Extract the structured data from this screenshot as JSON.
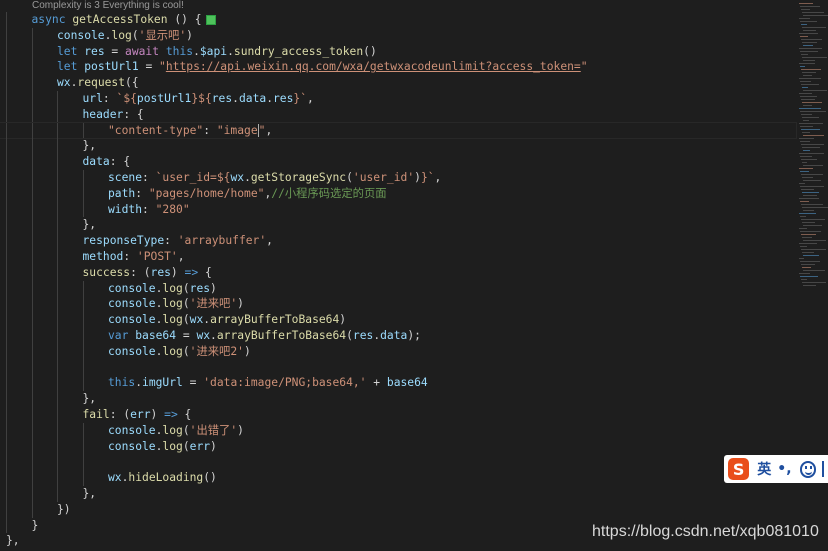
{
  "codelens": "Complexity is 3 Everything is cool!",
  "code": [
    {
      "indent": 1,
      "tokens": [
        [
          "kw",
          "async "
        ],
        [
          "fn",
          "getAccessToken"
        ],
        [
          "pun",
          " () {"
        ]
      ],
      "lens": true
    },
    {
      "indent": 2,
      "tokens": [
        [
          "var",
          "console"
        ],
        [
          "pun",
          "."
        ],
        [
          "fn",
          "log"
        ],
        [
          "pun",
          "("
        ],
        [
          "str",
          "'显示吧'"
        ],
        [
          "pun",
          ")"
        ]
      ]
    },
    {
      "indent": 2,
      "tokens": [
        [
          "kw",
          "let "
        ],
        [
          "var",
          "res"
        ],
        [
          "pun",
          " = "
        ],
        [
          "ctl",
          "await "
        ],
        [
          "kw",
          "this"
        ],
        [
          "pun",
          "."
        ],
        [
          "var",
          "$api"
        ],
        [
          "pun",
          "."
        ],
        [
          "fn",
          "sundry_access_token"
        ],
        [
          "pun",
          "()"
        ]
      ]
    },
    {
      "indent": 2,
      "tokens": [
        [
          "kw",
          "let "
        ],
        [
          "var",
          "postUrl1"
        ],
        [
          "pun",
          " = "
        ],
        [
          "str",
          "\""
        ],
        [
          "url",
          "https://api.weixin.qq.com/wxa/getwxacodeunlimit?access_token="
        ],
        [
          "str",
          "\""
        ]
      ]
    },
    {
      "indent": 2,
      "tokens": [
        [
          "var",
          "wx"
        ],
        [
          "pun",
          "."
        ],
        [
          "fn",
          "request"
        ],
        [
          "pun",
          "({"
        ]
      ]
    },
    {
      "indent": 3,
      "tokens": [
        [
          "var",
          "url"
        ],
        [
          "pun",
          ": "
        ],
        [
          "str",
          "`${"
        ],
        [
          "var",
          "postUrl1"
        ],
        [
          "str",
          "}${"
        ],
        [
          "var",
          "res"
        ],
        [
          "pun",
          "."
        ],
        [
          "var",
          "data"
        ],
        [
          "pun",
          "."
        ],
        [
          "var",
          "res"
        ],
        [
          "str",
          "}`"
        ],
        [
          "pun",
          ","
        ]
      ]
    },
    {
      "indent": 3,
      "tokens": [
        [
          "var",
          "header"
        ],
        [
          "pun",
          ": {"
        ]
      ]
    },
    {
      "indent": 4,
      "tokens": [
        [
          "str",
          "\"content-type\""
        ],
        [
          "pun",
          ": "
        ],
        [
          "str",
          "\"image"
        ],
        [
          "cursor",
          ""
        ],
        [
          "str",
          "\""
        ],
        [
          "pun",
          ","
        ]
      ],
      "current": true
    },
    {
      "indent": 3,
      "tokens": [
        [
          "pun",
          "},"
        ]
      ]
    },
    {
      "indent": 3,
      "tokens": [
        [
          "var",
          "data"
        ],
        [
          "pun",
          ": {"
        ]
      ]
    },
    {
      "indent": 4,
      "tokens": [
        [
          "var",
          "scene"
        ],
        [
          "pun",
          ": "
        ],
        [
          "str",
          "`user_id=${"
        ],
        [
          "var",
          "wx"
        ],
        [
          "pun",
          "."
        ],
        [
          "fn",
          "getStorageSync"
        ],
        [
          "pun",
          "("
        ],
        [
          "str",
          "'user_id'"
        ],
        [
          "pun",
          ")"
        ],
        [
          "str",
          "}`"
        ],
        [
          "pun",
          ","
        ]
      ]
    },
    {
      "indent": 4,
      "tokens": [
        [
          "var",
          "path"
        ],
        [
          "pun",
          ": "
        ],
        [
          "str",
          "\"pages/home/home\""
        ],
        [
          "pun",
          ","
        ],
        [
          "cmt",
          "//小程序码选定的页面"
        ]
      ]
    },
    {
      "indent": 4,
      "tokens": [
        [
          "var",
          "width"
        ],
        [
          "pun",
          ": "
        ],
        [
          "str",
          "\"280\""
        ]
      ]
    },
    {
      "indent": 3,
      "tokens": [
        [
          "pun",
          "},"
        ]
      ]
    },
    {
      "indent": 3,
      "tokens": [
        [
          "var",
          "responseType"
        ],
        [
          "pun",
          ": "
        ],
        [
          "str",
          "'arraybuffer'"
        ],
        [
          "pun",
          ","
        ]
      ]
    },
    {
      "indent": 3,
      "tokens": [
        [
          "var",
          "method"
        ],
        [
          "pun",
          ": "
        ],
        [
          "str",
          "'POST'"
        ],
        [
          "pun",
          ","
        ]
      ]
    },
    {
      "indent": 3,
      "tokens": [
        [
          "fn",
          "success"
        ],
        [
          "pun",
          ": ("
        ],
        [
          "var",
          "res"
        ],
        [
          "pun",
          ") "
        ],
        [
          "kw",
          "=>"
        ],
        [
          "pun",
          " {"
        ]
      ]
    },
    {
      "indent": 4,
      "tokens": [
        [
          "var",
          "console"
        ],
        [
          "pun",
          "."
        ],
        [
          "fn",
          "log"
        ],
        [
          "pun",
          "("
        ],
        [
          "var",
          "res"
        ],
        [
          "pun",
          ")"
        ]
      ]
    },
    {
      "indent": 4,
      "tokens": [
        [
          "var",
          "console"
        ],
        [
          "pun",
          "."
        ],
        [
          "fn",
          "log"
        ],
        [
          "pun",
          "("
        ],
        [
          "str",
          "'进来吧'"
        ],
        [
          "pun",
          ")"
        ]
      ]
    },
    {
      "indent": 4,
      "tokens": [
        [
          "var",
          "console"
        ],
        [
          "pun",
          "."
        ],
        [
          "fn",
          "log"
        ],
        [
          "pun",
          "("
        ],
        [
          "var",
          "wx"
        ],
        [
          "pun",
          "."
        ],
        [
          "fn",
          "arrayBufferToBase64"
        ],
        [
          "pun",
          ")"
        ]
      ]
    },
    {
      "indent": 4,
      "tokens": [
        [
          "kw",
          "var "
        ],
        [
          "var",
          "base64"
        ],
        [
          "pun",
          " = "
        ],
        [
          "var",
          "wx"
        ],
        [
          "pun",
          "."
        ],
        [
          "fn",
          "arrayBufferToBase64"
        ],
        [
          "pun",
          "("
        ],
        [
          "var",
          "res"
        ],
        [
          "pun",
          "."
        ],
        [
          "var",
          "data"
        ],
        [
          "pun",
          ");"
        ]
      ]
    },
    {
      "indent": 4,
      "tokens": [
        [
          "var",
          "console"
        ],
        [
          "pun",
          "."
        ],
        [
          "fn",
          "log"
        ],
        [
          "pun",
          "("
        ],
        [
          "str",
          "'进来吧2'"
        ],
        [
          "pun",
          ")"
        ]
      ]
    },
    {
      "indent": 4,
      "tokens": []
    },
    {
      "indent": 4,
      "tokens": [
        [
          "kw",
          "this"
        ],
        [
          "pun",
          "."
        ],
        [
          "var",
          "imgUrl"
        ],
        [
          "pun",
          " = "
        ],
        [
          "str",
          "'data:image/PNG;base64,'"
        ],
        [
          "pun",
          " + "
        ],
        [
          "var",
          "base64"
        ]
      ]
    },
    {
      "indent": 3,
      "tokens": [
        [
          "pun",
          "},"
        ]
      ]
    },
    {
      "indent": 3,
      "tokens": [
        [
          "fn",
          "fail"
        ],
        [
          "pun",
          ": ("
        ],
        [
          "var",
          "err"
        ],
        [
          "pun",
          ") "
        ],
        [
          "kw",
          "=>"
        ],
        [
          "pun",
          " {"
        ]
      ]
    },
    {
      "indent": 4,
      "tokens": [
        [
          "var",
          "console"
        ],
        [
          "pun",
          "."
        ],
        [
          "fn",
          "log"
        ],
        [
          "pun",
          "("
        ],
        [
          "str",
          "'出错了'"
        ],
        [
          "pun",
          ")"
        ]
      ]
    },
    {
      "indent": 4,
      "tokens": [
        [
          "var",
          "console"
        ],
        [
          "pun",
          "."
        ],
        [
          "fn",
          "log"
        ],
        [
          "pun",
          "("
        ],
        [
          "var",
          "err"
        ],
        [
          "pun",
          ")"
        ]
      ]
    },
    {
      "indent": 4,
      "tokens": []
    },
    {
      "indent": 4,
      "tokens": [
        [
          "var",
          "wx"
        ],
        [
          "pun",
          "."
        ],
        [
          "fn",
          "hideLoading"
        ],
        [
          "pun",
          "()"
        ]
      ]
    },
    {
      "indent": 3,
      "tokens": [
        [
          "pun",
          "},"
        ]
      ]
    },
    {
      "indent": 2,
      "tokens": [
        [
          "pun",
          "})"
        ]
      ]
    },
    {
      "indent": 1,
      "tokens": [
        [
          "pun",
          "}"
        ]
      ]
    },
    {
      "indent": 0,
      "tokens": [
        [
          "pun",
          "},"
        ]
      ]
    }
  ],
  "ime": {
    "logo": "S",
    "lang": "英",
    "punct": "•,"
  },
  "watermark": "https://blog.csdn.net/xqb081010"
}
